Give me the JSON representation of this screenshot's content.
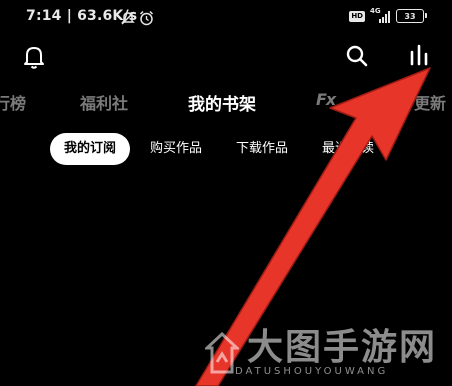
{
  "status_bar": {
    "time_speed": "7:14 | 63.6K/s",
    "hd_badge": "HD",
    "network": "4G",
    "battery": "33"
  },
  "toolbar": {
    "bell_icon": "bell-icon",
    "search_icon": "search-icon",
    "rank_icon": "ranking-icon"
  },
  "top_tabs": {
    "items": [
      "行榜",
      "福利社",
      "我的书架",
      "Fx",
      "更新"
    ],
    "active": "我的书架"
  },
  "sub_tabs": {
    "items": [
      "我的订阅",
      "购买作品",
      "下载作品",
      "最近阅读"
    ],
    "active": "我的订阅"
  },
  "annotation": {
    "arrow_color": "#e8352a"
  },
  "watermark": {
    "title": "大图手游网",
    "subtitle": "DATUSHOUYOUWANG"
  }
}
